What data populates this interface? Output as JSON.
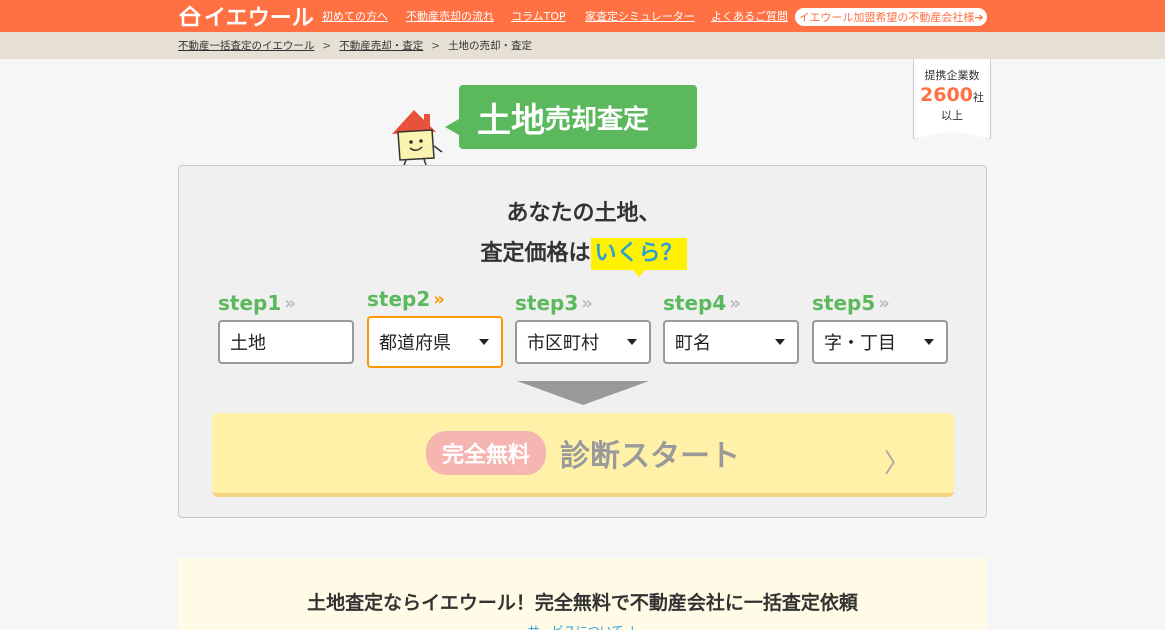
{
  "header": {
    "logo_text": "イエウール",
    "nav": [
      {
        "label": "初めての方へ"
      },
      {
        "label": "不動産売却の流れ"
      },
      {
        "label": "コラムTOP"
      },
      {
        "label": "家査定シミュレーター"
      },
      {
        "label": "よくあるご質問"
      }
    ],
    "cta_label": "イエウール加盟希望の不動産会社様➔"
  },
  "breadcrumb": {
    "items": [
      "不動産一括査定のイエウール",
      "不動産売却・査定",
      "土地の売却・査定"
    ],
    "separator": ">"
  },
  "ribbon": {
    "line1": "提携企業数",
    "count": "2600",
    "unit": "社",
    "line3": "以上"
  },
  "title_badge": {
    "big": "土地",
    "small": "売却査定"
  },
  "card": {
    "heading_line1": "あなたの土地、",
    "heading_line2_prefix": "査定価格は",
    "heading_highlight": "いくら？",
    "steps": [
      {
        "label": "step1",
        "value": "土地"
      },
      {
        "label": "step2",
        "value": "都道府県"
      },
      {
        "label": "step3",
        "value": "市区町村"
      },
      {
        "label": "step4",
        "value": "町名"
      },
      {
        "label": "step5",
        "value": "字・丁目"
      }
    ],
    "step_chevron": "»",
    "free_label": "完全無料",
    "start_label": "診断スタート",
    "start_chevron": "〉"
  },
  "band": {
    "title": "土地査定ならイエウール！完全無料で不動産会社に一括査定依頼",
    "link": "サービスについて ↓"
  },
  "colors": {
    "header": "#ff7043",
    "green": "#5cb85c",
    "highlight": "#fff200",
    "active_border": "#ff9800"
  }
}
